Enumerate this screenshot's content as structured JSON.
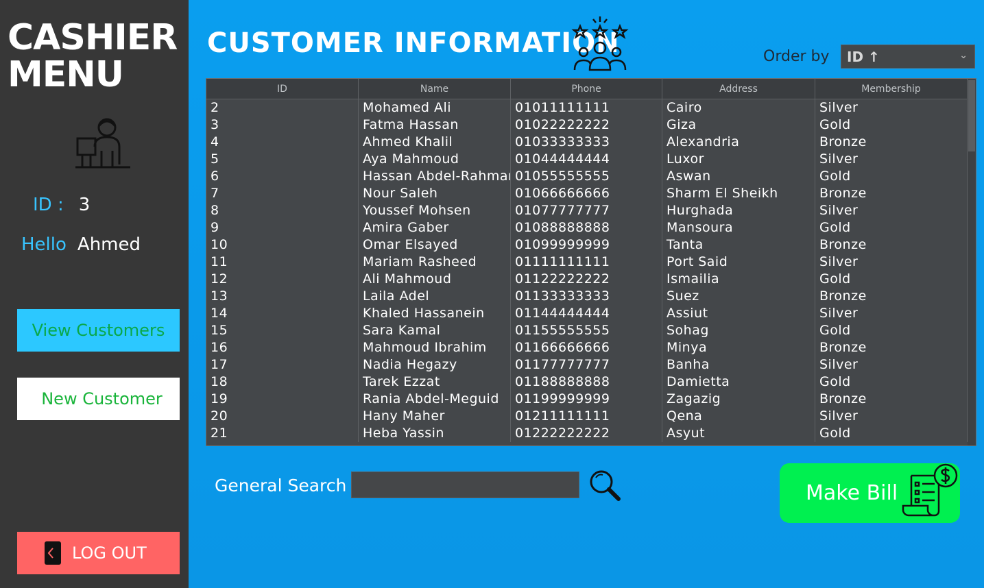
{
  "sidebar": {
    "brand_line1": "CASHIER",
    "brand_line2": "MENU",
    "id_label": "ID :",
    "id_value": "3",
    "hello_label": "Hello",
    "hello_value": "Ahmed",
    "view_customers": "View Customers",
    "new_customer": "New Customer",
    "logout": "LOG OUT"
  },
  "header": {
    "title": "CUSTOMER INFORMATION",
    "order_by_label": "Order by",
    "order_by_value": "ID ↑"
  },
  "table": {
    "columns": [
      "ID",
      "Name",
      "Phone",
      "Address",
      "Membership"
    ],
    "rows": [
      [
        "2",
        "Mohamed Ali",
        "01011111111",
        "Cairo",
        "Silver"
      ],
      [
        "3",
        "Fatma Hassan",
        "01022222222",
        "Giza",
        "Gold"
      ],
      [
        "4",
        "Ahmed Khalil",
        "01033333333",
        "Alexandria",
        "Bronze"
      ],
      [
        "5",
        "Aya Mahmoud",
        "01044444444",
        "Luxor",
        "Silver"
      ],
      [
        "6",
        "Hassan Abdel-Rahman",
        "01055555555",
        "Aswan",
        "Gold"
      ],
      [
        "7",
        "Nour Saleh",
        "01066666666",
        "Sharm El Sheikh",
        "Bronze"
      ],
      [
        "8",
        "Youssef Mohsen",
        "01077777777",
        "Hurghada",
        "Silver"
      ],
      [
        "9",
        "Amira Gaber",
        "01088888888",
        "Mansoura",
        "Gold"
      ],
      [
        "10",
        "Omar Elsayed",
        "01099999999",
        "Tanta",
        "Bronze"
      ],
      [
        "11",
        "Mariam Rasheed",
        "01111111111",
        "Port Said",
        "Silver"
      ],
      [
        "12",
        "Ali Mahmoud",
        "01122222222",
        "Ismailia",
        "Gold"
      ],
      [
        "13",
        "Laila Adel",
        "01133333333",
        "Suez",
        "Bronze"
      ],
      [
        "14",
        "Khaled Hassanein",
        "01144444444",
        "Assiut",
        "Silver"
      ],
      [
        "15",
        "Sara Kamal",
        "01155555555",
        "Sohag",
        "Gold"
      ],
      [
        "16",
        "Mahmoud Ibrahim",
        "01166666666",
        "Minya",
        "Bronze"
      ],
      [
        "17",
        "Nadia Hegazy",
        "01177777777",
        "Banha",
        "Silver"
      ],
      [
        "18",
        "Tarek Ezzat",
        "01188888888",
        "Damietta",
        "Gold"
      ],
      [
        "19",
        "Rania Abdel-Meguid",
        "01199999999",
        "Zagazig",
        "Bronze"
      ],
      [
        "20",
        "Hany Maher",
        "01211111111",
        "Qena",
        "Silver"
      ],
      [
        "21",
        "Heba Yassin",
        "01222222222",
        "Asyut",
        "Gold"
      ]
    ]
  },
  "search": {
    "label": "General Search",
    "value": ""
  },
  "actions": {
    "make_bill": "Make Bill"
  },
  "icons": {
    "cashier": "cashier-icon",
    "customers": "customers-rating-icon",
    "logout": "door-icon",
    "search": "magnifier-icon",
    "bill": "bill-icon"
  },
  "colors": {
    "sidebar_bg": "#373737",
    "main_bg": "#0a9eef",
    "accent_cyan": "#2cc8ff",
    "logout_red": "#ff6464",
    "bill_green": "#00f050"
  }
}
